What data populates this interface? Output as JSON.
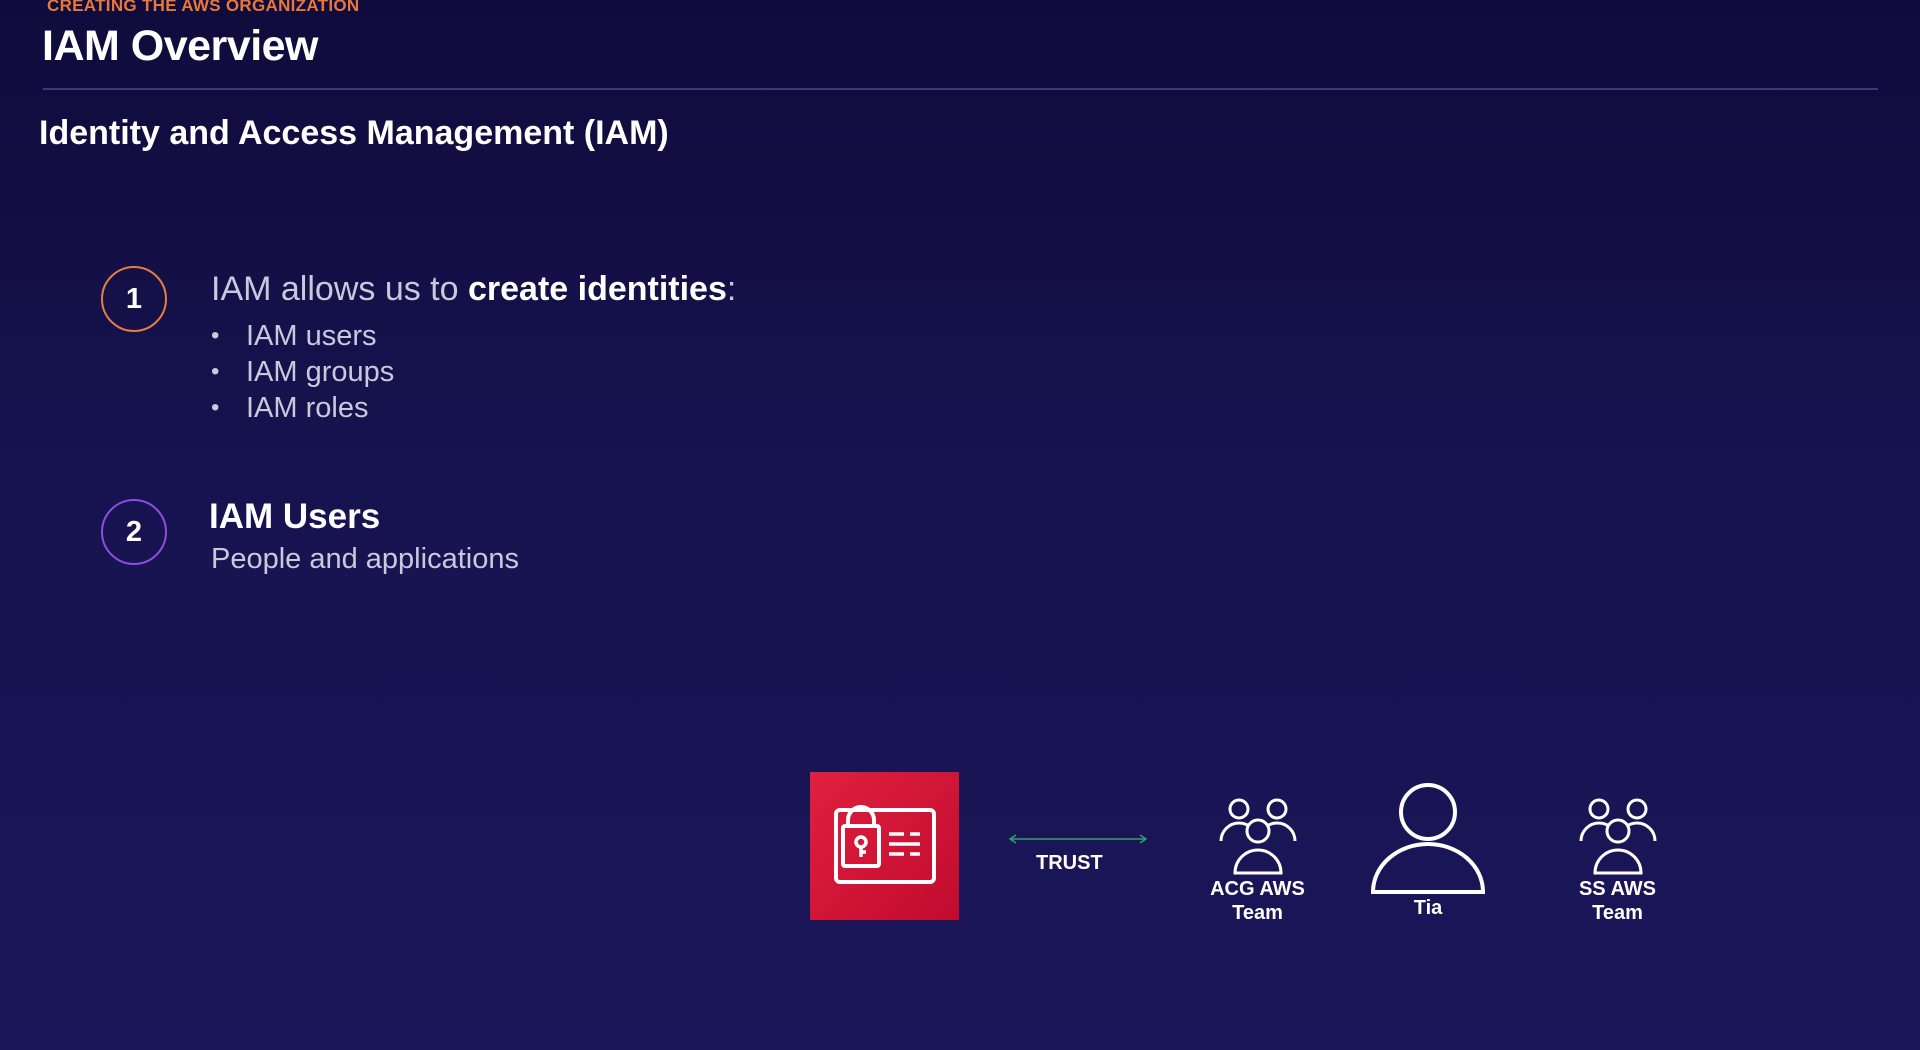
{
  "header": {
    "kicker": "CREATING THE AWS ORGANIZATION",
    "title": "IAM Overview"
  },
  "section": {
    "subtitle": "Identity and Access Management (IAM)"
  },
  "points": [
    {
      "number": "1",
      "lead": "IAM allows us to ",
      "emphasis": "create identities",
      "tail": ":",
      "bullets": [
        "IAM users",
        "IAM groups",
        "IAM roles"
      ]
    },
    {
      "number": "2",
      "heading": "IAM Users",
      "description": "People and applications"
    }
  ],
  "diagram": {
    "service_icon": "iam-identity-card-lock-icon",
    "trust_label": "TRUST",
    "entities": [
      {
        "icon": "group-users-icon",
        "label_line1": "ACG AWS",
        "label_line2": "Team"
      },
      {
        "icon": "user-icon",
        "label_line1": "Tia"
      },
      {
        "icon": "group-users-icon",
        "label_line1": "SS AWS",
        "label_line2": "Team"
      }
    ]
  },
  "colors": {
    "background": "#17134f",
    "kicker": "#e8783a",
    "circle_1": "#e67f3e",
    "circle_2": "#8a4fe0",
    "iam_red": "#d0163a",
    "trust_arrow": "#2fa36b"
  }
}
